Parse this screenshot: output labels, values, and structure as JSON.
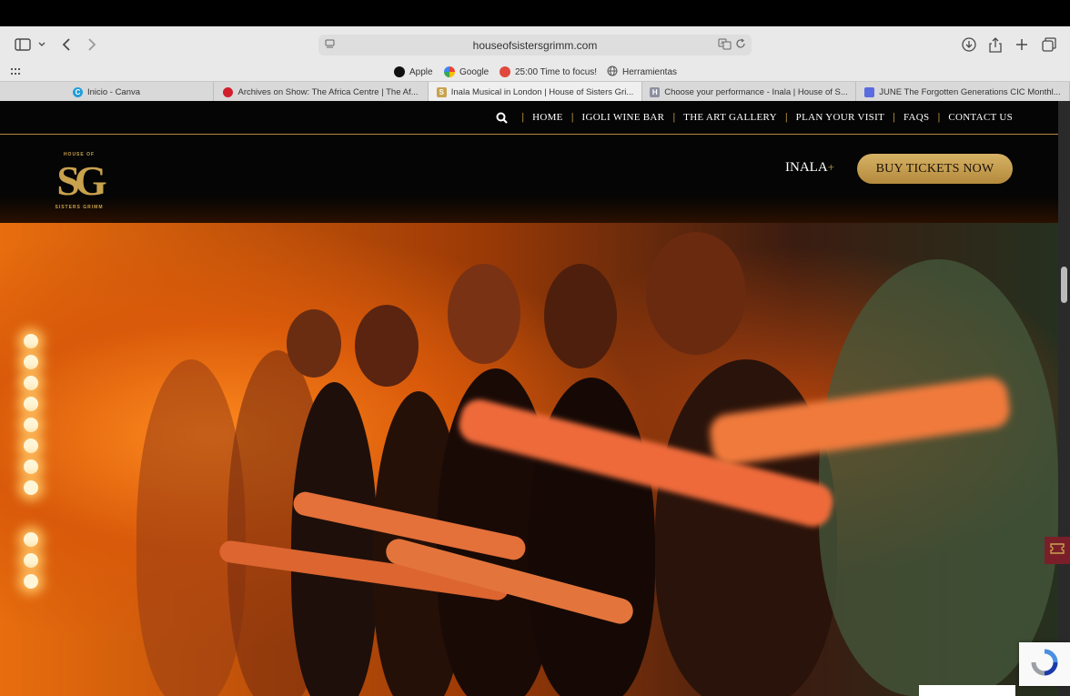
{
  "browser": {
    "url": "houseofsistersgrimm.com",
    "favorites": [
      {
        "label": "Apple",
        "icon": "apple-icon"
      },
      {
        "label": "Google",
        "icon": "google-icon"
      },
      {
        "label": "25:00 Time to focus!",
        "icon": "timer-icon"
      },
      {
        "label": "Herramientas",
        "icon": "globe-icon"
      }
    ],
    "tabs": [
      {
        "label": "Inicio - Canva",
        "icon": "canva-icon",
        "active": false,
        "color": "#1f9dd9"
      },
      {
        "label": "Archives on Show: The Africa Centre | The Af...",
        "icon": "africa-centre-icon",
        "active": false,
        "color": "#d11f2c"
      },
      {
        "label": "Inala Musical in London | House of Sisters Gri...",
        "icon": "sg-icon",
        "active": true,
        "color": "#c9a24e"
      },
      {
        "label": "Choose your performance - Inala | House of S...",
        "icon": "h-icon",
        "active": false,
        "color": "#8c8fa0"
      },
      {
        "label": "JUNE The Forgotten Generations CIC Monthl...",
        "icon": "calendar-icon",
        "active": false,
        "color": "#5b6be0"
      }
    ]
  },
  "site": {
    "nav": [
      "HOME",
      "IGOLI WINE BAR",
      "THE ART GALLERY",
      "PLAN YOUR VISIT",
      "FAQS",
      "CONTACT US"
    ],
    "nav_separator": "|",
    "logo": {
      "top": "HOUSE OF",
      "main": "SG",
      "bottom": "SISTERS GRIMM"
    },
    "inala_label": "INALA",
    "inala_plus": "+",
    "buy_button": "BUY TICKETS NOW",
    "accent_color": "#c9a24e",
    "hero_alt": "Performers on stage with outstretched arms in warm orange light"
  }
}
